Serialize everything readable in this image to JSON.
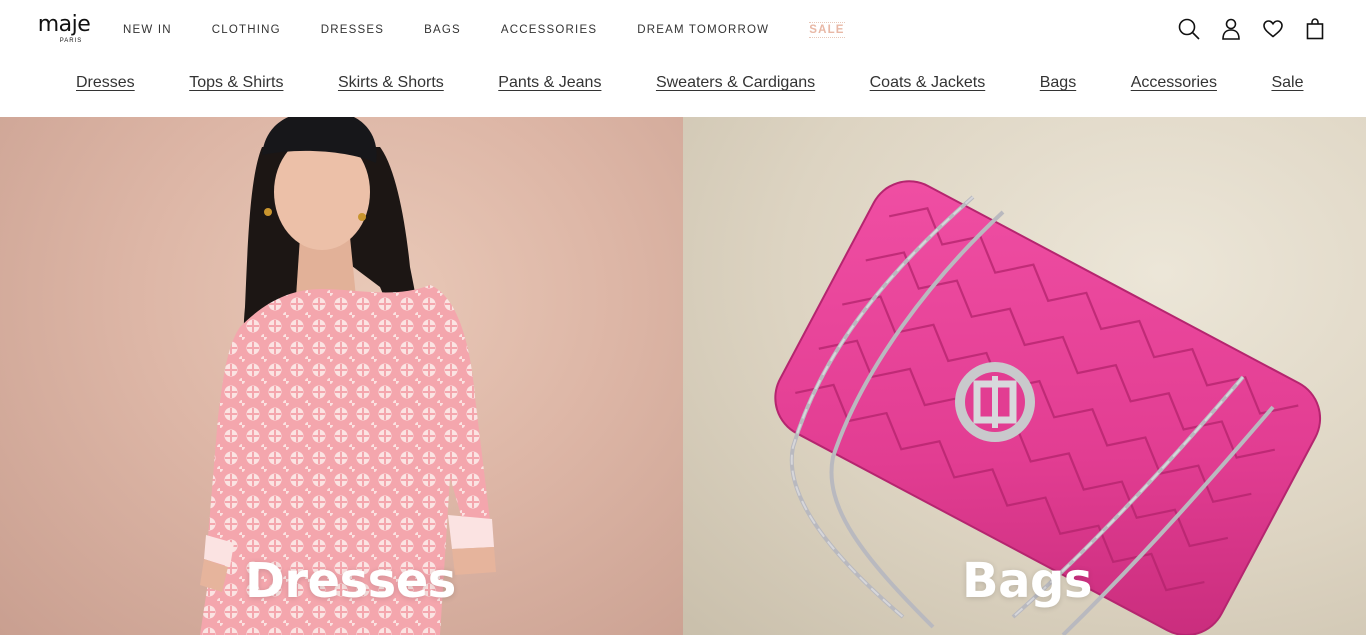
{
  "brand": {
    "name": "maje",
    "tagline": "PARIS"
  },
  "top_nav": [
    {
      "label": "NEW IN"
    },
    {
      "label": "CLOTHING"
    },
    {
      "label": "DRESSES"
    },
    {
      "label": "BAGS"
    },
    {
      "label": "ACCESSORIES"
    },
    {
      "label": "DREAM TOMORROW"
    },
    {
      "label": "SALE"
    }
  ],
  "header_icons": [
    "search-icon",
    "account-icon",
    "wishlist-heart-icon",
    "shopping-bag-icon"
  ],
  "category_nav": [
    {
      "label": "Dresses"
    },
    {
      "label": "Tops & Shirts"
    },
    {
      "label": "Skirts & Shorts"
    },
    {
      "label": "Pants & Jeans"
    },
    {
      "label": "Sweaters & Cardigans"
    },
    {
      "label": "Coats & Jackets"
    },
    {
      "label": "Bags"
    },
    {
      "label": "Accessories"
    },
    {
      "label": "Sale"
    }
  ],
  "tiles": [
    {
      "label": "Dresses"
    },
    {
      "label": "Bags"
    }
  ],
  "colors": {
    "sale_accent": "#e8b8a6",
    "dress_pink": "#f2a9ad",
    "bag_pink": "#e8459a"
  }
}
